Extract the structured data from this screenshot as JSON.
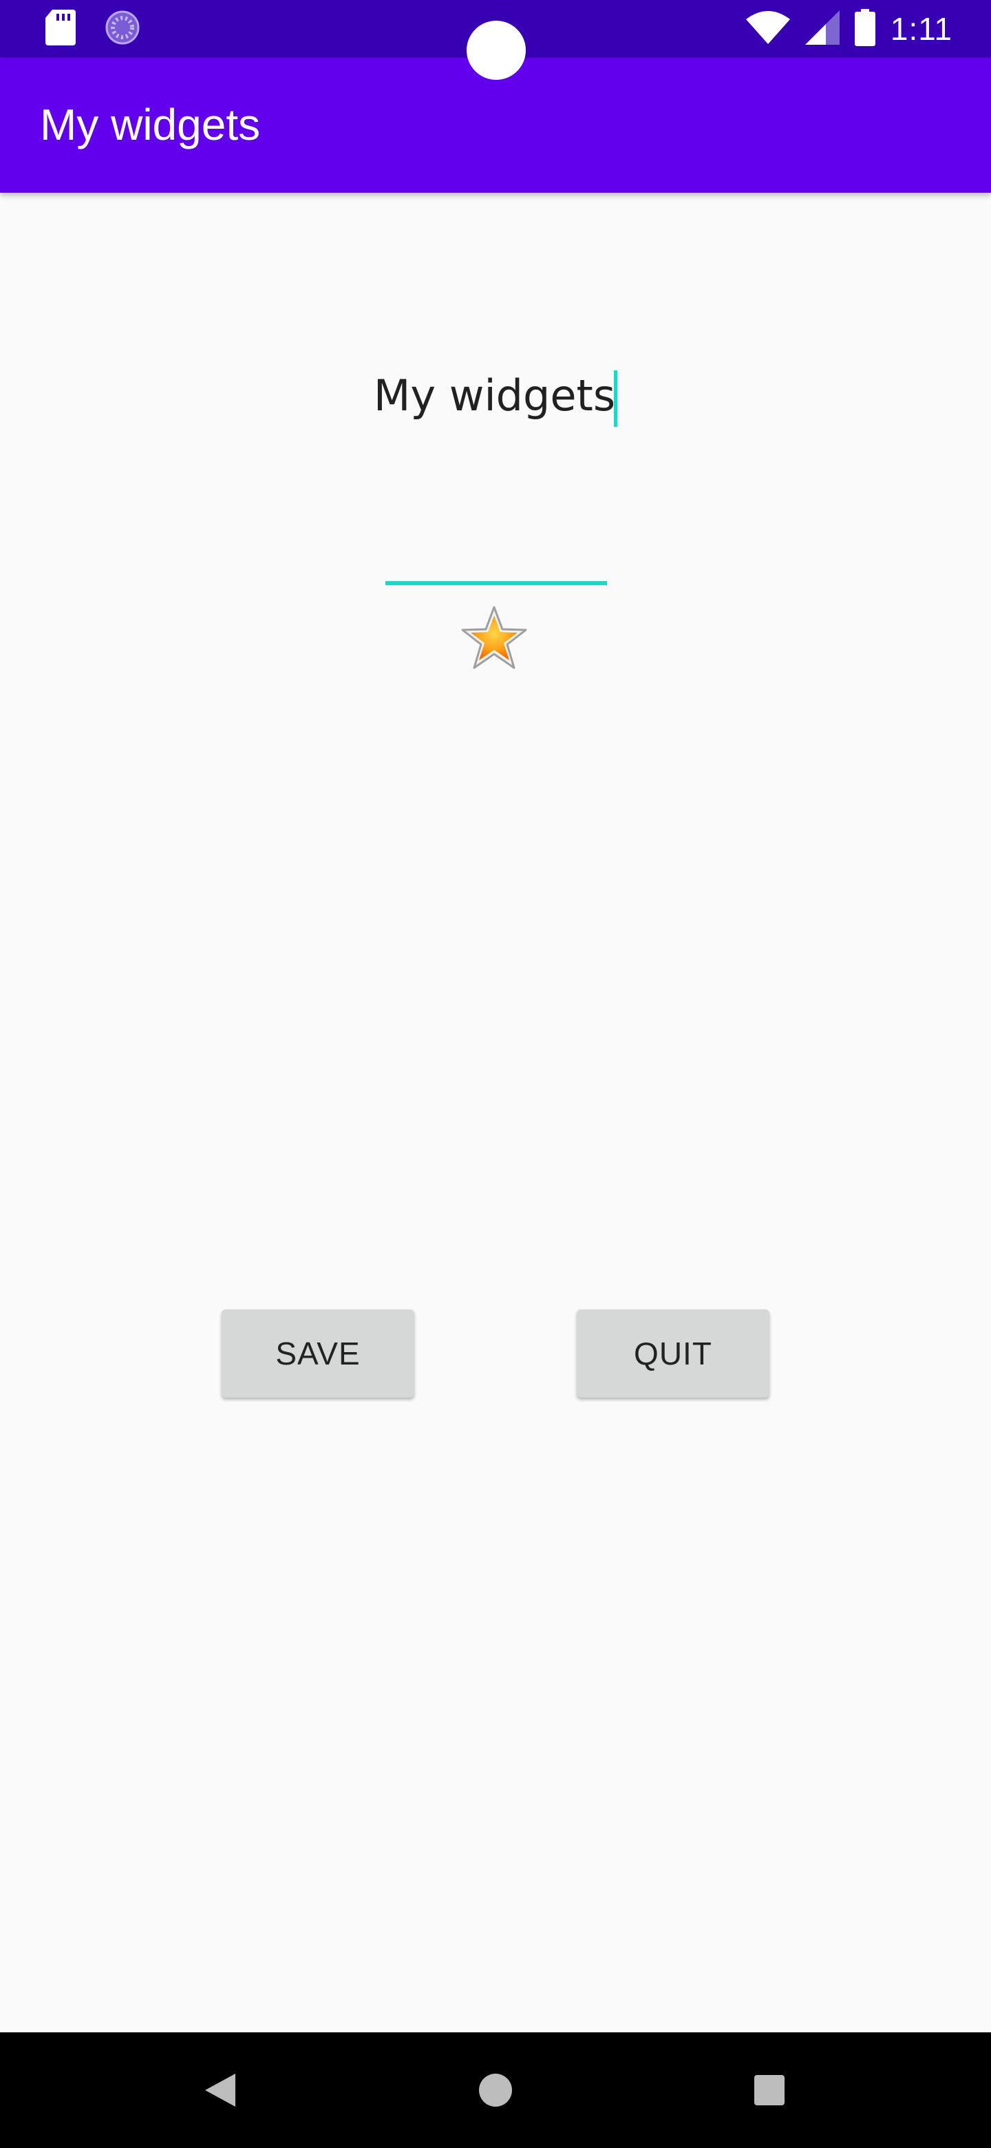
{
  "status_bar": {
    "time": "1:11",
    "icons": [
      "sd-card-icon",
      "loading-icon",
      "wifi-icon",
      "signal-icon",
      "battery-icon"
    ]
  },
  "app_bar": {
    "title": "My widgets"
  },
  "content": {
    "display_text": "My widgets",
    "edit_field_value": "",
    "star_icon": "star-icon"
  },
  "buttons": {
    "save_label": "SAVE",
    "quit_label": "QUIT"
  },
  "nav_bar": {
    "icons": [
      "back-icon",
      "home-icon",
      "recents-icon"
    ]
  },
  "colors": {
    "status_bar": "#3700B3",
    "app_bar": "#6200EE",
    "accent": "#1DD8C6",
    "background": "#FAFAFA",
    "button": "#D6D7D7"
  }
}
